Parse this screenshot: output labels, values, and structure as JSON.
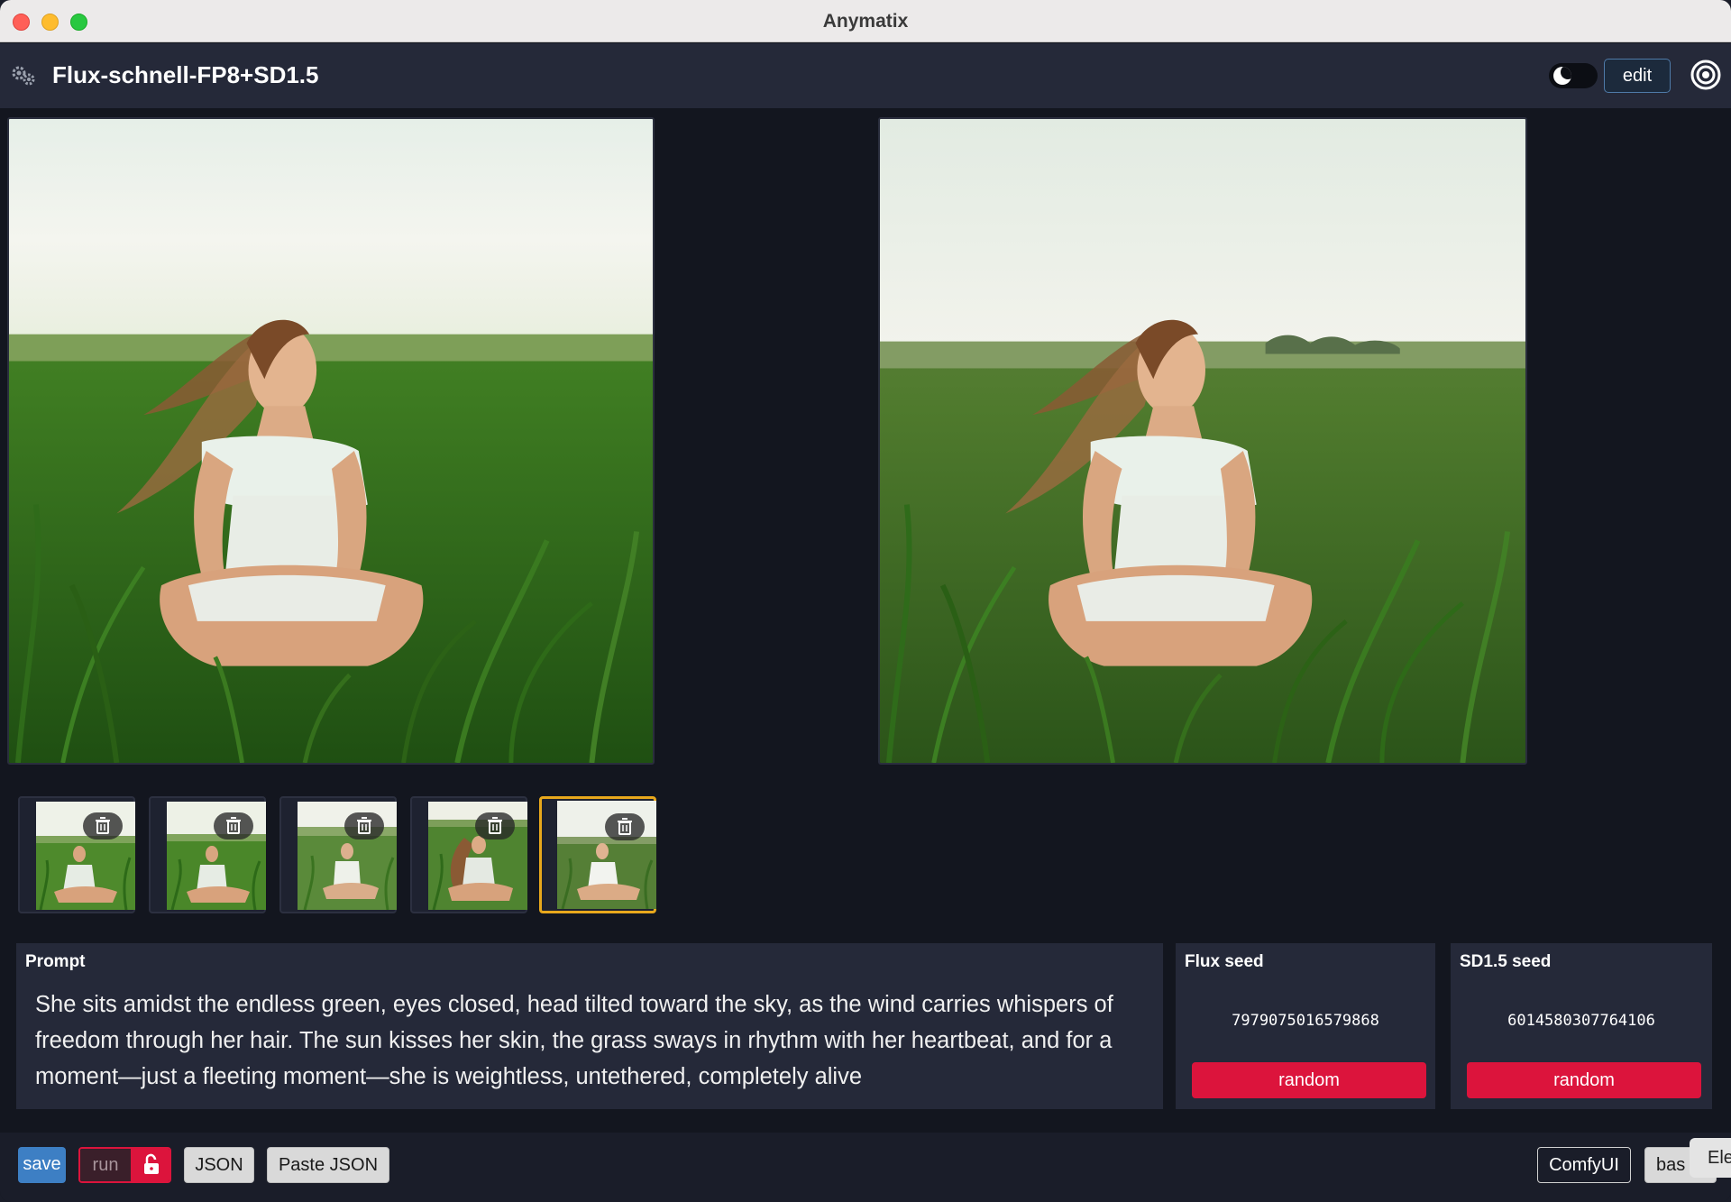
{
  "window": {
    "title": "Anymatix"
  },
  "header": {
    "app_title": "Flux-schnell-FP8+SD1.5",
    "edit_label": "edit"
  },
  "prompt": {
    "label": "Prompt",
    "text": "She sits amidst the endless green, eyes closed, head tilted toward the sky, as the wind carries whispers of freedom through her hair. The sun kisses her skin, the grass sways in rhythm with her heartbeat, and for a moment—just a fleeting moment—she is weightless, untethered, completely alive"
  },
  "seeds": [
    {
      "label": "Flux seed",
      "value": "7979075016579868",
      "button": "random"
    },
    {
      "label": "SD1.5 seed",
      "value": "6014580307764106",
      "button": "random"
    }
  ],
  "thumbnails": [
    {
      "selected": false
    },
    {
      "selected": false
    },
    {
      "selected": false
    },
    {
      "selected": false
    },
    {
      "selected": true
    }
  ],
  "toolbar": {
    "save_label": "save",
    "run_label": "run",
    "json_label": "JSON",
    "paste_json_label": "Paste JSON",
    "comfyui_label": "ComfyUI",
    "bas_label": "bas",
    "ele_label": "Ele"
  },
  "icons": {
    "gear": "gear-icon",
    "target": "target-icon",
    "trash": "trash-icon",
    "lock": "unlock-icon",
    "theme": "moon-icon"
  },
  "colors": {
    "accent_red": "#dc143c",
    "save_blue": "#3d7fc4",
    "selected_border": "#e8a81c",
    "panel_bg": "#252939",
    "app_bg": "#13161f"
  }
}
